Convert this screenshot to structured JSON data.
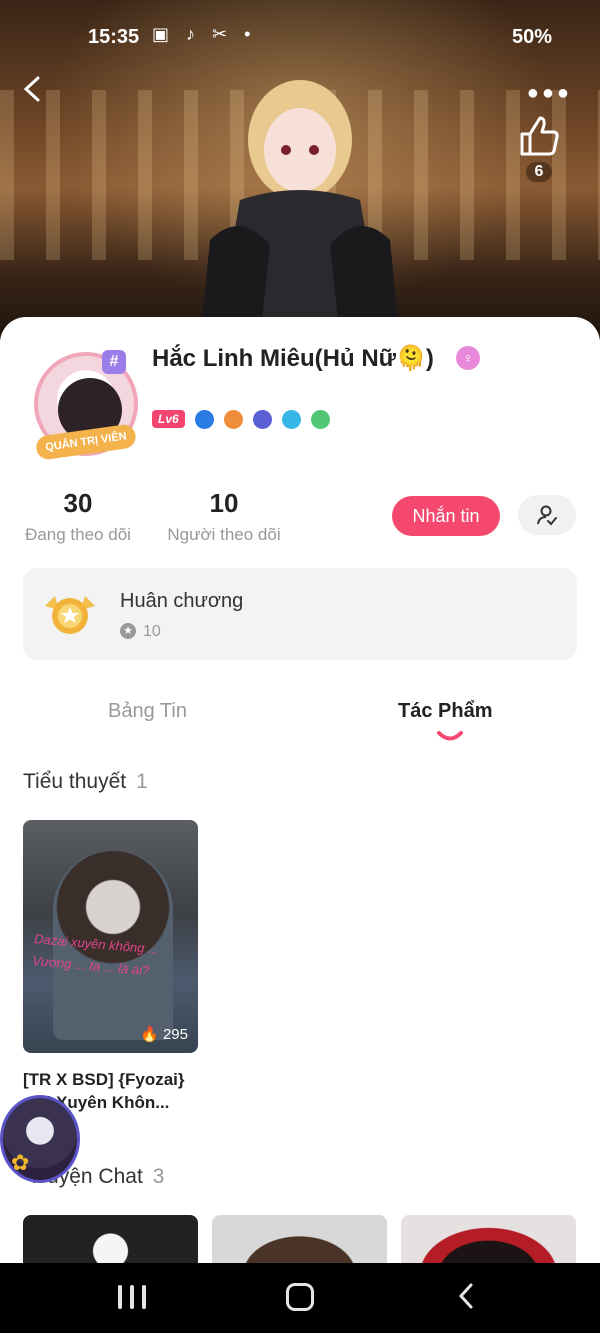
{
  "status_bar": {
    "time": "15:35",
    "icons_left": [
      "image-icon",
      "tiktok-icon",
      "capcut-icon",
      "dot-icon"
    ],
    "icons_right": [
      "alarm-icon",
      "wifi-icon",
      "signal-icon"
    ],
    "battery": "50%"
  },
  "header": {
    "like_count": "6"
  },
  "profile": {
    "avatar_ribbon": "QUẢN TRỊ VIÊN",
    "avatar_tag": "#",
    "username": "Hắc Linh Miêu(Hủ Nữ🫠)",
    "gender_icon": "female-icon",
    "level": "Lv6",
    "badge_colors": [
      "#2a7be4",
      "#f08d3c",
      "#5a5fd6",
      "#36b6e7",
      "#4fc774"
    ]
  },
  "stats": {
    "following_count": "30",
    "following_label": "Đang theo dõi",
    "followers_count": "10",
    "followers_label": "Người theo dõi"
  },
  "actions": {
    "message_label": "Nhắn tin"
  },
  "medal": {
    "title": "Huân chương",
    "count": "10"
  },
  "tabs": [
    {
      "label": "Bảng Tin",
      "active": false
    },
    {
      "label": "Tác Phẩm",
      "active": true
    }
  ],
  "sections": {
    "novels": {
      "title": "Tiểu thuyết",
      "count": "1",
      "items": [
        {
          "name": "[TR X BSD] {Fyozai} ...ai Xuyên Khôn...",
          "cover_text": "Dazai xuyên không ... Vương ... ta ... là ai?",
          "reads": "295"
        }
      ]
    },
    "chats": {
      "title": "Truyện Chat",
      "count": "3"
    }
  },
  "colors": {
    "accent": "#f4486f",
    "tab_indicator": "#f4486f"
  }
}
